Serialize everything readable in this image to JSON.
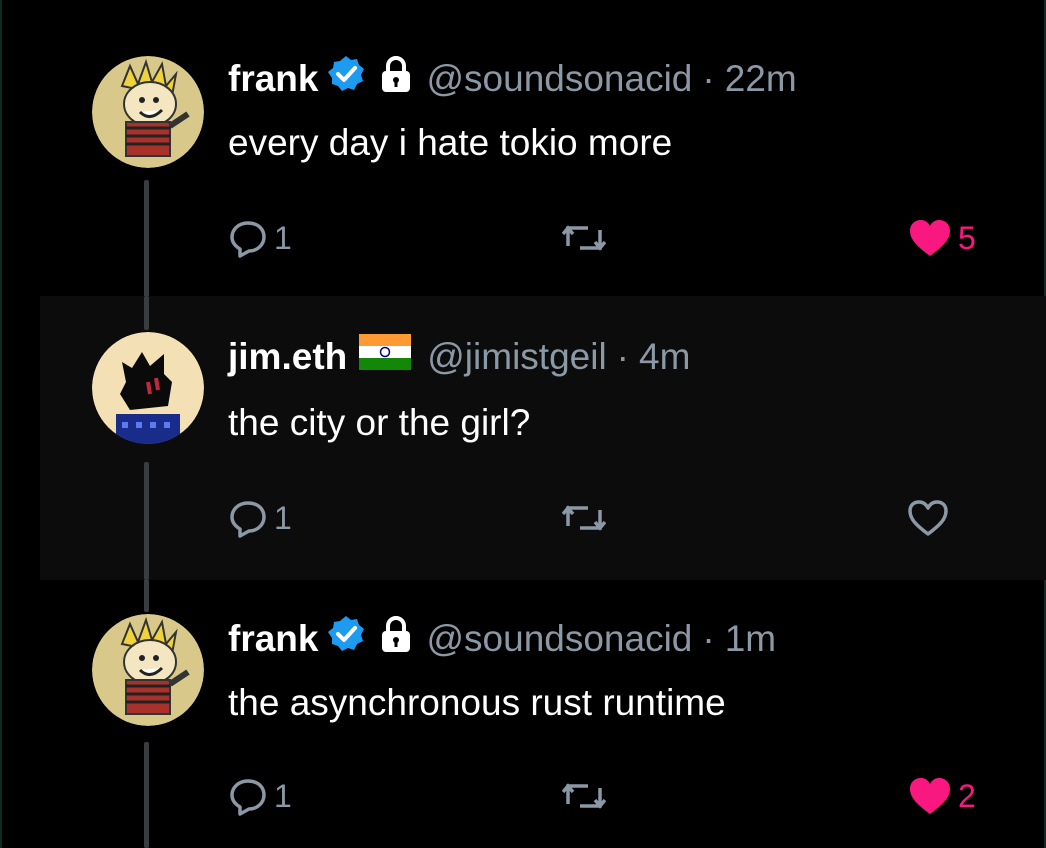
{
  "tweets": [
    {
      "name": "frank",
      "handle": "@soundsonacid",
      "separator": "·",
      "time": "22m",
      "text": "every day i hate tokio more",
      "reply_count": "1",
      "like_count": "5",
      "liked": true,
      "verified": true,
      "locked": true
    },
    {
      "name": "jim.eth",
      "handle": "@jimistgeil",
      "separator": "·",
      "time": "4m",
      "text": "the city or the girl?",
      "reply_count": "1",
      "like_count": "",
      "liked": false,
      "flag": "india-flag-icon"
    },
    {
      "name": "frank",
      "handle": "@soundsonacid",
      "separator": "·",
      "time": "1m",
      "text": "the asynchronous rust runtime",
      "reply_count": "1",
      "like_count": "2",
      "liked": true,
      "verified": true,
      "locked": true
    }
  ],
  "colors": {
    "background": "#000000",
    "highlight": "#0c0c0c",
    "name": "#ffffff",
    "secondary": "#8b98a5",
    "like": "#f91880",
    "verified": "#1d9bf0"
  }
}
